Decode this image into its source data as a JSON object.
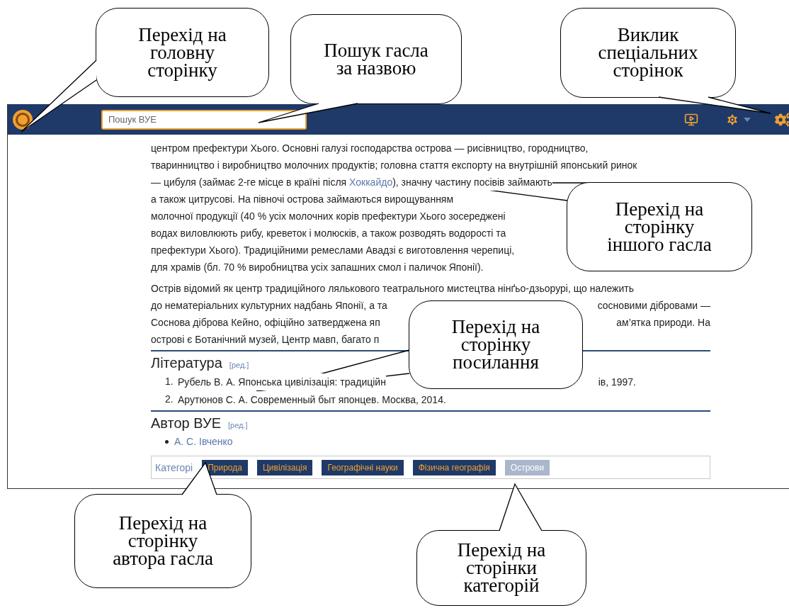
{
  "header": {
    "search": {
      "placeholder": "Пошук ВУЕ"
    }
  },
  "article": {
    "paragraphs": [
      {
        "lines": [
          [
            [
              {
                "kind": "text",
                "text": "центром префектури Хього. Основні галузі господарства острова — рисівництво, городництво,"
              }
            ]
          ],
          [
            [
              {
                "kind": "text",
                "text": "тваринництво і виробництво молочних продуктів; головна стаття експорту на внутрішній японський ринок"
              }
            ]
          ],
          [
            [
              {
                "kind": "text",
                "text": "— цибуля (займає 2-ге місце в країні після "
              },
              {
                "kind": "link",
                "text": "Хоккайдо"
              },
              {
                "kind": "text",
                "text": "), значну частину посівів займають"
              }
            ]
          ],
          [
            [
              {
                "kind": "text",
                "text": "а також цитрусові. На півночі острова займаються вирощуванням"
              }
            ]
          ],
          [
            [
              {
                "kind": "text",
                "text": "молочної продукції (40 % усіх молочних корів префектури Хього зосереджені"
              }
            ]
          ],
          [
            [
              {
                "kind": "text",
                "text": "водах виловлюють рибу, креветок і молюсків, а також розводять водорості та"
              }
            ]
          ],
          [
            [
              {
                "kind": "text",
                "text": "префектури Хього). Традиційними ремеслами Авадзі є виготовлення черепиці,"
              }
            ]
          ],
          [
            [
              {
                "kind": "text",
                "text": "для храмів (бл. 70 % виробництва усіх запашних смол і паличок Японії)."
              }
            ]
          ]
        ]
      },
      {
        "lines": [
          [
            [
              {
                "kind": "text",
                "text": "Острів відомий як центр традиційного лялькового театрального мистецтва нінґьо-дзьорурі, що належить"
              }
            ]
          ],
          [
            [
              {
                "kind": "text",
                "text": "до нематеріальних культурних надбань Японії, а та"
              }
            ],
            [
              {
                "kind": "text",
                "text": "сосновими дібровами —"
              }
            ]
          ],
          [
            [
              {
                "kind": "text",
                "text": "Соснова діброва Кейно, офіційно затверджена яп"
              }
            ],
            [
              {
                "kind": "text",
                "text": "ам’ятка природи. На"
              }
            ]
          ],
          [
            [
              {
                "kind": "text",
                "text": "острові є Ботанічний музей, Центр мавп, багато п"
              }
            ]
          ]
        ]
      }
    ],
    "sections": [
      {
        "title": "Література",
        "edit": "[ред.]",
        "kind": "ordered",
        "items": [
          {
            "number": "1.",
            "fragments": [
              [
                {
                  "kind": "text",
                  "text": "Рубель В. А. Японська цивілізація: традиційн"
                }
              ],
              [
                {
                  "kind": "text",
                  "text": "ів, 1997."
                }
              ]
            ]
          },
          {
            "number": "2.",
            "fragments": [
              [
                {
                  "kind": "text",
                  "text": "Арутюнов С. А. Современный быт японцев. Москва, 2014."
                }
              ]
            ]
          }
        ]
      },
      {
        "title": "Автор ВУЕ",
        "edit": "[ред.]",
        "kind": "bullets",
        "items": [
          {
            "fragments": [
              [
                {
                  "kind": "link",
                  "text": "А. С. Івченко"
                }
              ]
            ]
          }
        ]
      }
    ],
    "categories": {
      "label": "Категорі",
      "items": [
        {
          "text": "Природа",
          "muted": false
        },
        {
          "text": "Цивілізація",
          "muted": false
        },
        {
          "text": "Географічні науки",
          "muted": false
        },
        {
          "text": "Фізична географія",
          "muted": false
        },
        {
          "text": "Острови",
          "muted": true
        }
      ]
    }
  },
  "callouts": [
    {
      "lines": [
        "Перехід на",
        "головну",
        "сторінку"
      ]
    },
    {
      "lines": [
        "Пошук гасла",
        "за назвою"
      ]
    },
    {
      "lines": [
        "Виклик",
        "спеціальних",
        "сторінок"
      ]
    },
    {
      "lines": [
        "Перехід на",
        "сторінку",
        "іншого гасла"
      ]
    },
    {
      "lines": [
        "Перехід на",
        "сторінку",
        "посилання"
      ]
    },
    {
      "lines": [
        "Перехід на",
        "сторінку",
        "автора гасла"
      ]
    },
    {
      "lines": [
        "Перехід на",
        "сторінки",
        "категорій"
      ]
    }
  ]
}
